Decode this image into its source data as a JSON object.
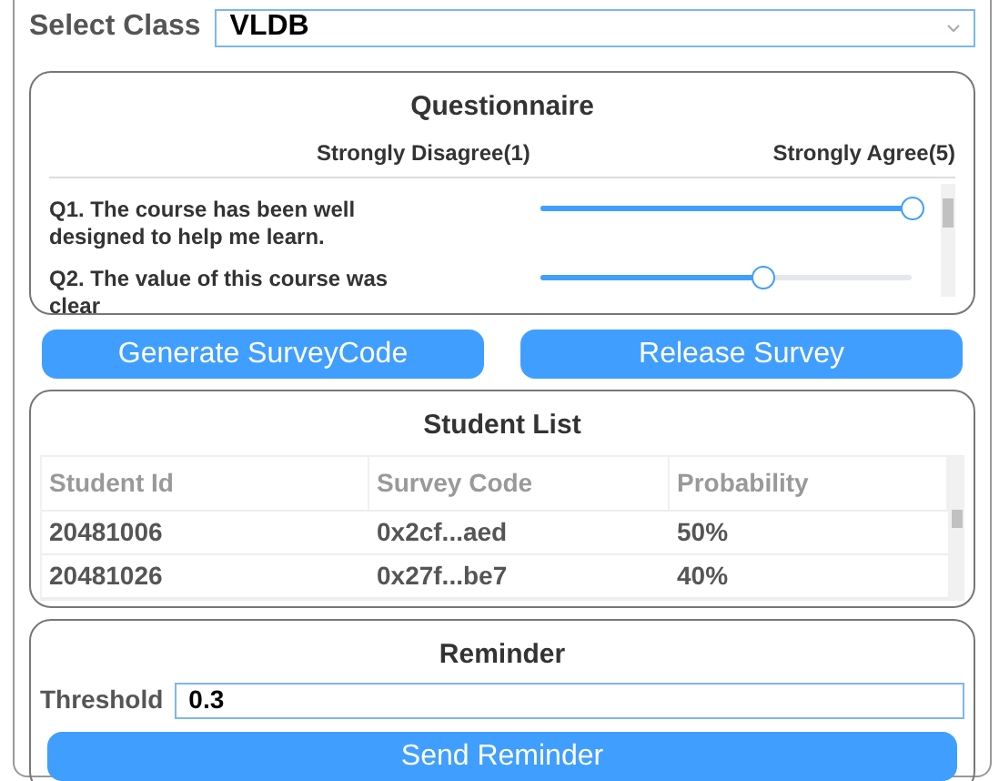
{
  "select_class": {
    "label": "Select Class",
    "value": "VLDB"
  },
  "questionnaire": {
    "title": "Questionnaire",
    "scale_low": "Strongly Disagree(1)",
    "scale_high": "Strongly Agree(5)",
    "questions": [
      {
        "text": "Q1. The course has been well designed to help me learn.",
        "level": 1
      },
      {
        "text": "Q2. The value of this course was clear",
        "level": 0.6
      }
    ]
  },
  "buttons": [
    "Generate SurveyCode",
    "Release Survey"
  ],
  "student_list": {
    "title": "Student List",
    "columns": [
      "Student Id",
      "Survey Code",
      "Probability"
    ],
    "rows": [
      [
        "20481006",
        "0x2cf...aed",
        "50%"
      ],
      [
        "20481026",
        "0x27f...be7",
        "40%"
      ]
    ]
  },
  "reminder": {
    "title": "Reminder",
    "threshold_label": "Threshold",
    "threshold_value": "0.3",
    "button": "Send Reminder"
  }
}
